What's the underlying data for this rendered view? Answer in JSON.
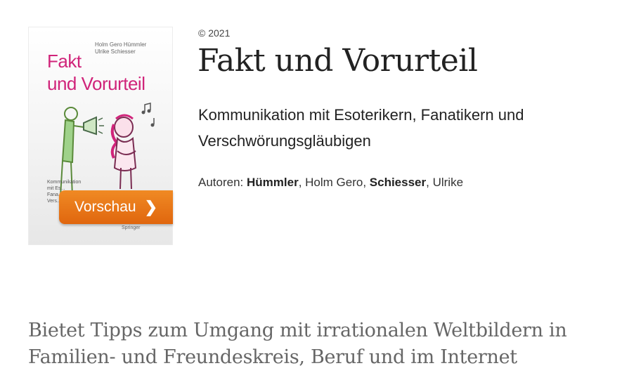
{
  "cover": {
    "authors": [
      "Holm Gero Hümmler",
      "Ulrike Schiesser"
    ],
    "title_lines": [
      "Fakt",
      "und Vorurteil"
    ],
    "subtitle_lines": [
      "Kommunikation",
      "mit Es...",
      "Fana...",
      "Vers..."
    ],
    "publisher": "Springer",
    "title_color": "#d0247a"
  },
  "preview_button": {
    "label": "Vorschau",
    "icon": "chevron-right-icon",
    "color": "#e8741a"
  },
  "book": {
    "copyright": "© 2021",
    "title": "Fakt und Vorurteil",
    "subtitle_line1": "Kommunikation mit Esoterikern, Fanatikern und",
    "subtitle_line2": "Verschwörungsgläubigen",
    "authors_label": "Autoren:",
    "author1_last": "Hümmler",
    "author1_first": ", Holm Gero,",
    "author2_last": "Schiesser",
    "author2_first": ", Ulrike"
  },
  "description": {
    "line1": "Bietet Tipps zum Umgang mit irrationalen Weltbildern in",
    "line2": "Familien- und Freundeskreis, Beruf und im Internet"
  }
}
